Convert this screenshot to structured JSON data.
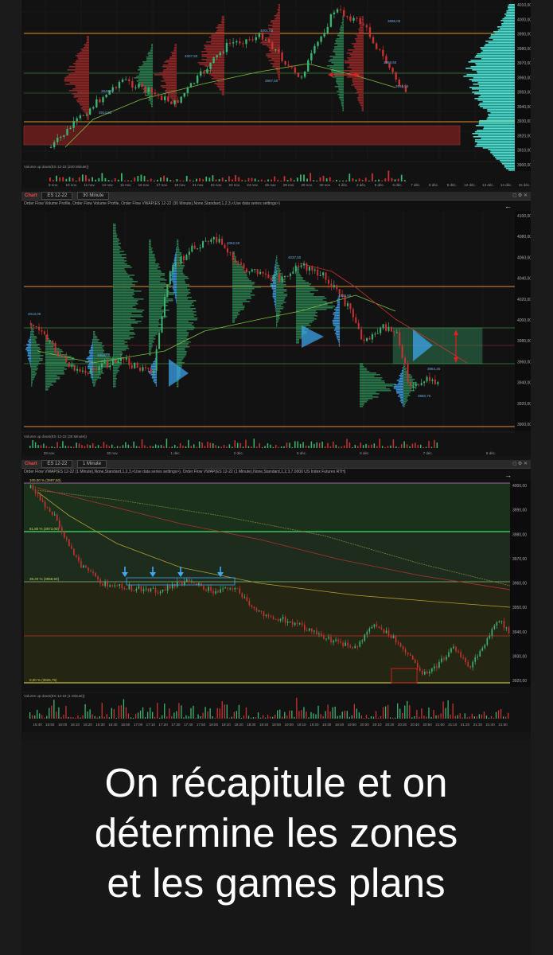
{
  "charts": {
    "top": {
      "price_labels": [
        "4010,00",
        "4000,00",
        "3990,00",
        "3980,00",
        "3970,00",
        "3960,00",
        "3950,00",
        "3940,00",
        "3930,00",
        "3920,00",
        "3910,00",
        "3900,00"
      ],
      "x_labels": [
        "9 nov.",
        "10 nov.",
        "11 nov.",
        "14 nov.",
        "15 nov.",
        "16 nov.",
        "17 nov.",
        "18 nov.",
        "21 nov.",
        "22 nov.",
        "23 nov.",
        "24 nov.",
        "25 nov.",
        "28 nov.",
        "29 nov.",
        "30 nov.",
        "1 déc.",
        "2 déc.",
        "5 déc.",
        "6 déc.",
        "7 déc.",
        "8 déc.",
        "9 déc.",
        "12 déc.",
        "13 déc.",
        "14 déc.",
        "15 déc."
      ],
      "annotations": [
        "4001,02",
        "4007,50",
        "3914,55",
        "3967,50",
        "3946,00",
        "3969,50",
        "3996,00",
        "3946,50"
      ],
      "volume_label": "Volume up down(ES 12-22 (240 Minute))"
    },
    "middle": {
      "toolbar": {
        "brand": "Chart",
        "instrument": "ES 12-22",
        "interval": "30 Minute"
      },
      "legend": "Order Flow Volume Profile, Order Flow Volume Profile, Order Flow VWAP(ES 12-22 (30 Minute),None,Standard,1,2,3,<Use data series settings>)",
      "price_labels": [
        "4100,00",
        "4080,00",
        "4060,00",
        "4040,00",
        "4020,00",
        "4000,00",
        "3980,00",
        "3960,00",
        "3940,00",
        "3920,00",
        "3900,00"
      ],
      "x_labels": [
        "29 nov.",
        "30 nov.",
        "1 déc.",
        "2 déc.",
        "5 déc.",
        "6 déc.",
        "7 déc.",
        "8 déc."
      ],
      "annotations": [
        "4013,00",
        "4062,50",
        "4037,50",
        "4026,50",
        "3982,50",
        "3964,25",
        "3960,75"
      ],
      "volume_label": "Volume up down(ES 12-22 (30 Minute))"
    },
    "bottom": {
      "toolbar": {
        "brand": "Chart",
        "instrument": "ES 12-22",
        "interval": "1 Minute"
      },
      "legend": "Order Flow VWAP(ES 12-22 (1 Minute),None,Standard,1,2,3,<Use data series settings>), Order Flow VWAP(ES 12-22 (1 Minute),None,Standard,1,2,3,7.0000 US Index Futures RTH)",
      "fib_labels": [
        "100,00 % (3997,50)",
        "61,80 % (3973,00)",
        "38,20 % (3958,50)",
        "0,00 % (3926,75)"
      ],
      "price_labels": [
        "4000,00",
        "3990,00",
        "3980,00",
        "3970,00",
        "3960,00",
        "3950,00",
        "3940,00",
        "3930,00",
        "3920,00"
      ],
      "x_labels": [
        "15:40",
        "15:50",
        "16:00",
        "16:10",
        "16:20",
        "16:30",
        "16:40",
        "16:50",
        "17:00",
        "17:10",
        "17:20",
        "17:30",
        "17:40",
        "17:50",
        "18:00",
        "18:10",
        "18:20",
        "18:30",
        "18:40",
        "18:50",
        "19:00",
        "19:10",
        "19:20",
        "19:30",
        "19:40",
        "19:50",
        "20:00",
        "20:10",
        "20:20",
        "20:30",
        "20:40",
        "20:50",
        "21:00",
        "21:10",
        "21:20",
        "21:30",
        "21:40",
        "21:50"
      ],
      "volume_label": "Volume up down(ES 12-22 (1 Minute))"
    }
  },
  "caption": {
    "lines": [
      "On récapitule et on",
      "détermine les zones",
      "et les games plans"
    ]
  },
  "colors": {
    "up": "#3cb371",
    "down": "#c83232",
    "profile_green": "#2e8b57",
    "profile_red": "#a52a2a",
    "profile_cyan": "#48e0d0",
    "blue": "#3fa9f5",
    "orange": "#e0902e",
    "vwap": "#7fbf3f"
  }
}
